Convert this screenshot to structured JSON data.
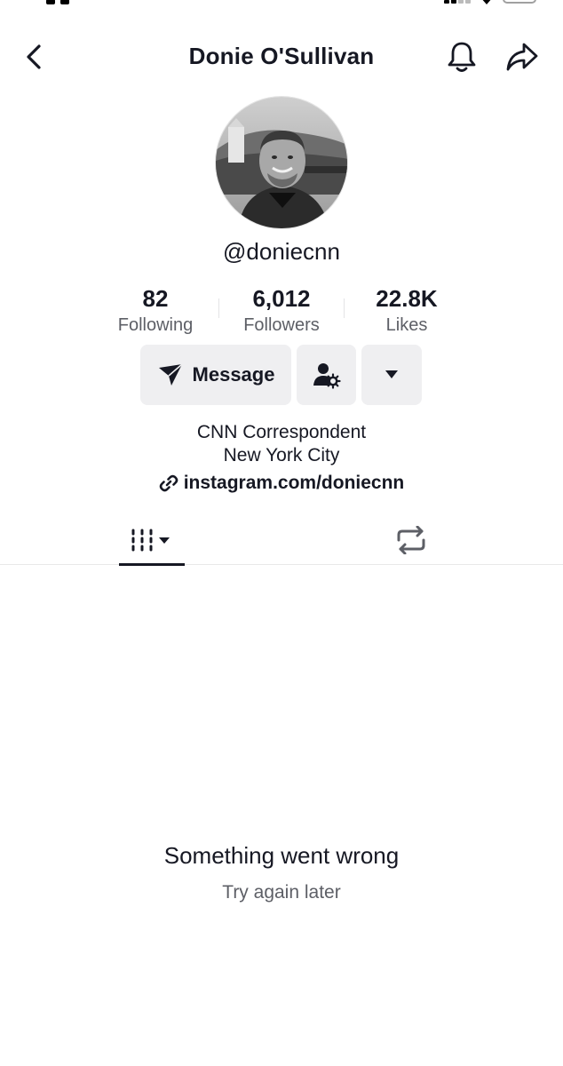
{
  "header": {
    "title": "Donie O'Sullivan",
    "back_icon": "chevron-left-icon",
    "bell_icon": "bell-icon",
    "share_icon": "share-icon"
  },
  "profile": {
    "username": "@doniecnn",
    "avatar_alt": "profile photo"
  },
  "stats": [
    {
      "value": "82",
      "label": "Following"
    },
    {
      "value": "6,012",
      "label": "Followers"
    },
    {
      "value": "22.8K",
      "label": "Likes"
    }
  ],
  "actions": {
    "message_label": "Message",
    "message_icon": "send-icon",
    "follow_settings_icon": "person-settings-icon",
    "more_icon": "caret-down-icon"
  },
  "bio": {
    "lines": [
      "CNN Correspondent",
      "New York City"
    ],
    "link_text": "instagram.com/doniecnn",
    "link_icon": "link-icon"
  },
  "tabs": [
    {
      "name": "videos",
      "icon": "grid-bars-icon",
      "active": true
    },
    {
      "name": "reposts",
      "icon": "repost-icon",
      "active": false
    }
  ],
  "empty_state": {
    "title": "Something went wrong",
    "subtitle": "Try again later"
  },
  "colors": {
    "text_primary": "#161823",
    "text_secondary": "#5d5f66",
    "button_bg": "#efeff1"
  }
}
